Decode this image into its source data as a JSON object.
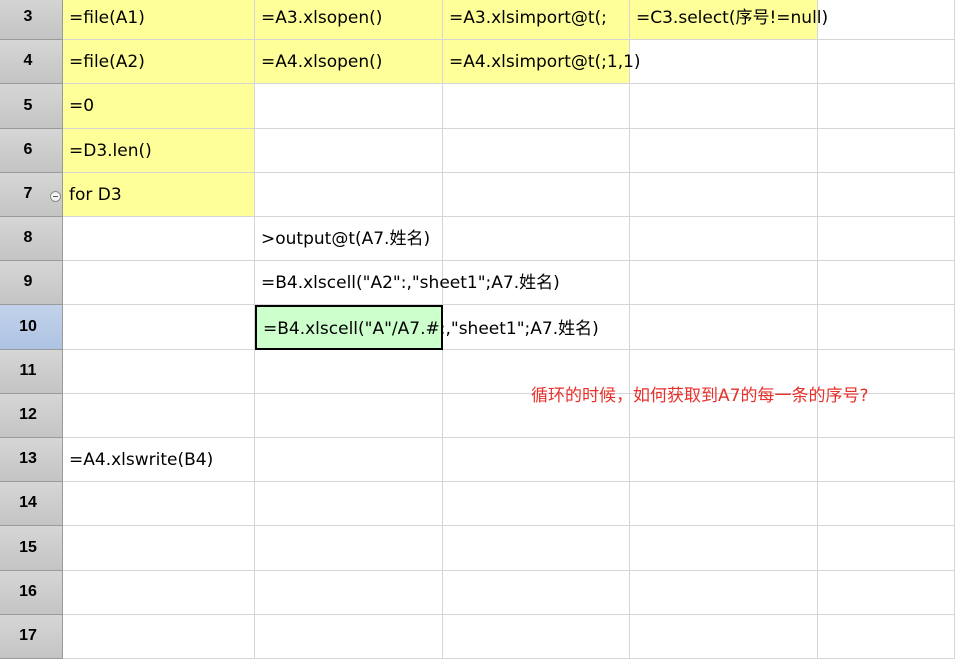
{
  "rows": [
    {
      "num": "3",
      "collapse": false,
      "cells": {
        "A": "=file(A1)",
        "B": "=A3.xlsopen()",
        "C": "=A3.xlsimport@t(;",
        "D": "=C3.select(序号!=null)"
      },
      "yellow": [
        "A",
        "B",
        "C",
        "D"
      ]
    },
    {
      "num": "4",
      "collapse": false,
      "cells": {
        "A": "=file(A2)",
        "B": "=A4.xlsopen()",
        "C": "=A4.xlsimport@t(;1,1)"
      },
      "yellow": [
        "A",
        "B",
        "C"
      ]
    },
    {
      "num": "5",
      "collapse": false,
      "cells": {
        "A": "=0"
      },
      "yellow": [
        "A"
      ]
    },
    {
      "num": "6",
      "collapse": false,
      "cells": {
        "A": "=D3.len()"
      },
      "yellow": [
        "A"
      ]
    },
    {
      "num": "7",
      "collapse": true,
      "cells": {
        "A": "for D3"
      },
      "yellow": [
        "A"
      ]
    },
    {
      "num": "8",
      "collapse": false,
      "cells": {
        "B": ">output@t(A7.姓名)"
      },
      "yellow": []
    },
    {
      "num": "9",
      "collapse": false,
      "cells": {
        "B": "=B4.xlscell(\"A2\":,\"sheet1\";A7.姓名)"
      },
      "yellow": []
    },
    {
      "num": "10",
      "collapse": false,
      "selected": true,
      "cells": {
        "B": "=B4.xlscell(\"A\"/A7.#:,\"sheet1\";A7.姓名)"
      },
      "yellow": [],
      "active": "B"
    },
    {
      "num": "11",
      "collapse": false,
      "cells": {},
      "yellow": []
    },
    {
      "num": "12",
      "collapse": false,
      "cells": {},
      "yellow": []
    },
    {
      "num": "13",
      "collapse": false,
      "cells": {
        "A": "=A4.xlswrite(B4)"
      },
      "yellow": []
    },
    {
      "num": "14",
      "collapse": false,
      "cells": {},
      "yellow": []
    },
    {
      "num": "15",
      "collapse": false,
      "cells": {},
      "yellow": []
    },
    {
      "num": "16",
      "collapse": false,
      "cells": {},
      "yellow": []
    },
    {
      "num": "17",
      "collapse": false,
      "cells": {},
      "yellow": []
    }
  ],
  "comment": "循环的时候，如何获取到A7的每一条的序号?",
  "colors": {
    "cell_yellow": "#ffff99",
    "active_cell": "#ccffcc",
    "header_grey": "#c8c8c8",
    "selected_header": "#b4c8e6",
    "comment_red": "#e8312b"
  }
}
